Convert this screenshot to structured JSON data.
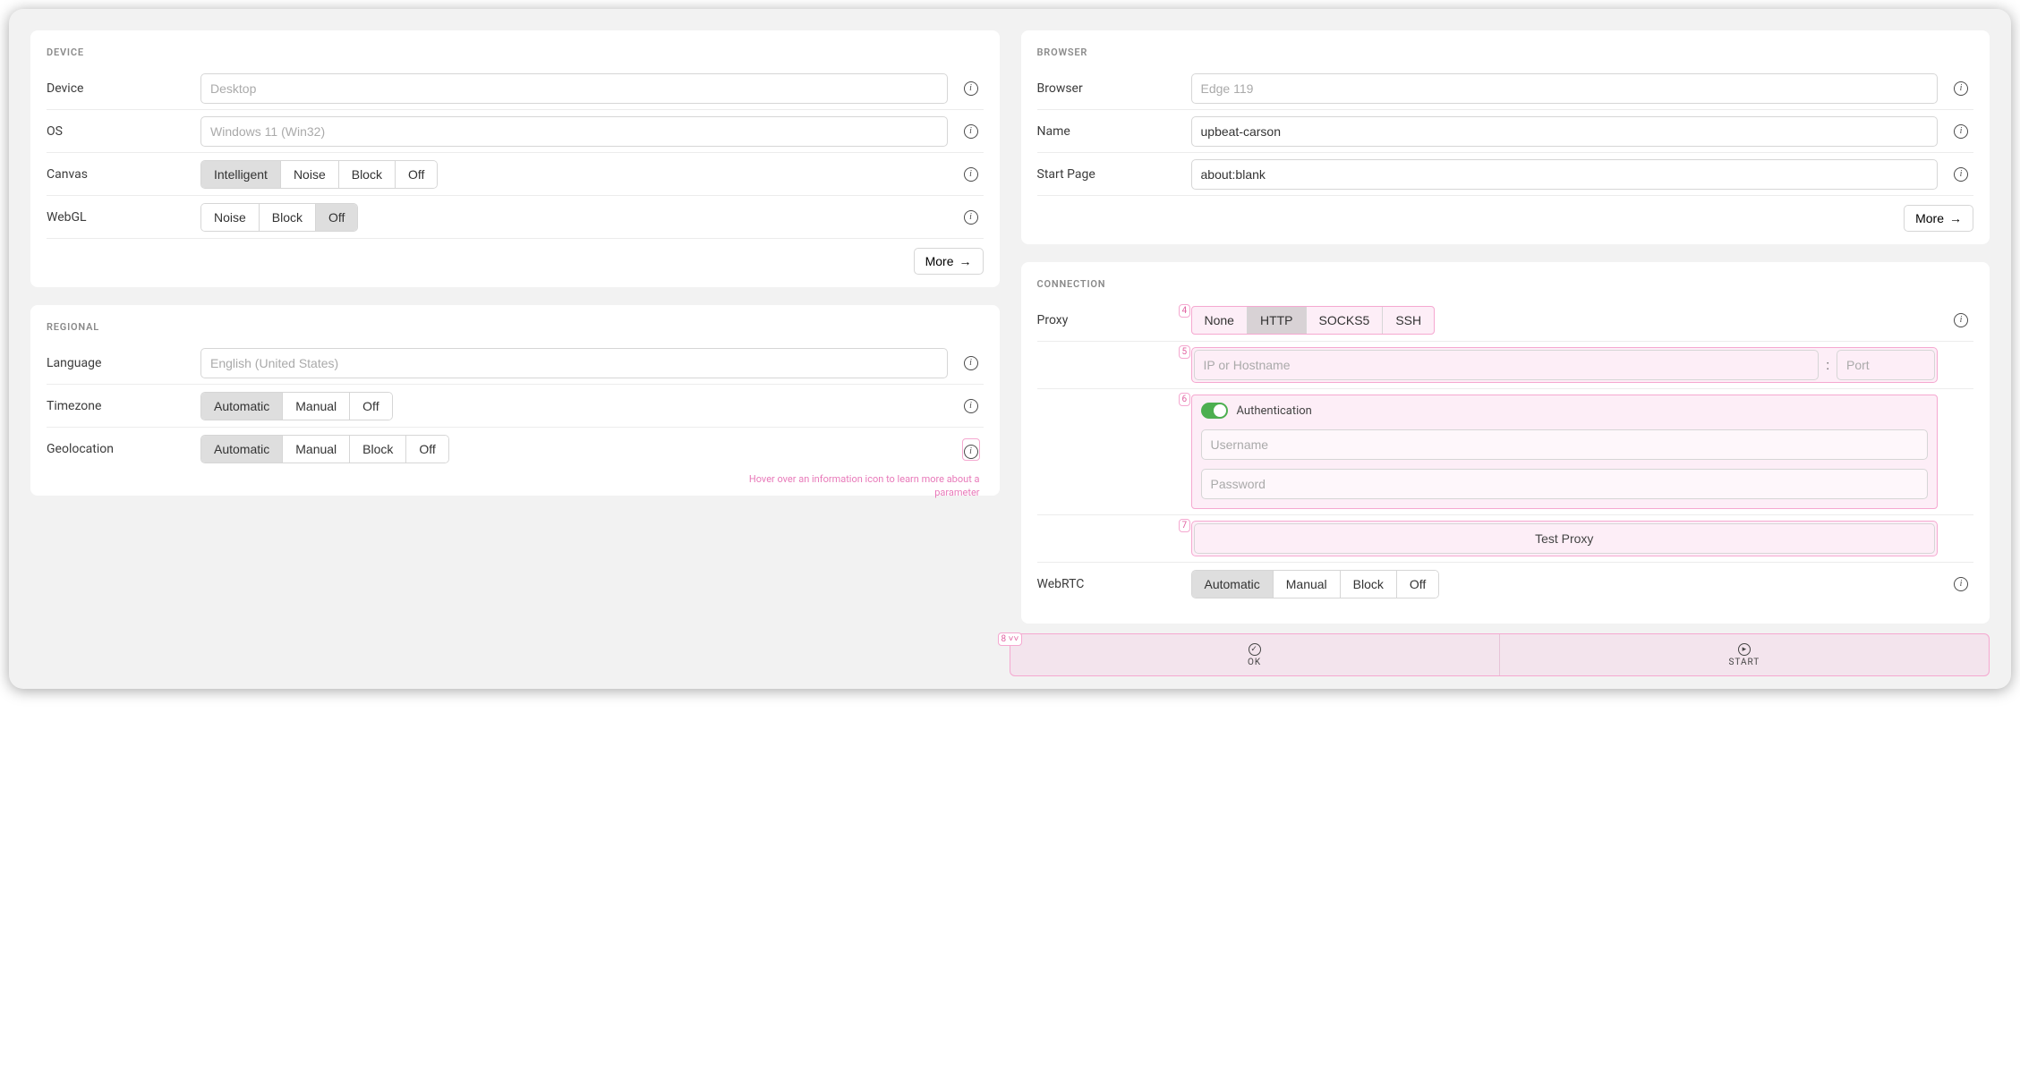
{
  "device": {
    "title": "DEVICE",
    "device_label": "Device",
    "device_placeholder": "Desktop",
    "os_label": "OS",
    "os_placeholder": "Windows 11 (Win32)",
    "canvas_label": "Canvas",
    "canvas_options": [
      "Intelligent",
      "Noise",
      "Block",
      "Off"
    ],
    "canvas_selected": "Intelligent",
    "webgl_label": "WebGL",
    "webgl_options": [
      "Noise",
      "Block",
      "Off"
    ],
    "webgl_selected": "Off",
    "more": "More"
  },
  "regional": {
    "title": "REGIONAL",
    "language_label": "Language",
    "language_placeholder": "English (United States)",
    "timezone_label": "Timezone",
    "timezone_options": [
      "Automatic",
      "Manual",
      "Off"
    ],
    "timezone_selected": "Automatic",
    "geolocation_label": "Geolocation",
    "geolocation_options": [
      "Automatic",
      "Manual",
      "Block",
      "Off"
    ],
    "geolocation_selected": "Automatic",
    "hint": "Hover over an information icon to learn more about a parameter"
  },
  "browser": {
    "title": "BROWSER",
    "browser_label": "Browser",
    "browser_placeholder": "Edge 119",
    "name_label": "Name",
    "name_value": "upbeat-carson",
    "startpage_label": "Start Page",
    "startpage_value": "about:blank",
    "more": "More"
  },
  "connection": {
    "title": "CONNECTION",
    "proxy_label": "Proxy",
    "proxy_options": [
      "None",
      "HTTP",
      "SOCKS5",
      "SSH"
    ],
    "proxy_selected": "HTTP",
    "host_placeholder": "IP or Hostname",
    "port_placeholder": "Port",
    "auth_label": "Authentication",
    "username_placeholder": "Username",
    "password_placeholder": "Password",
    "test_label": "Test Proxy",
    "webrtc_label": "WebRTC",
    "webrtc_options": [
      "Automatic",
      "Manual",
      "Block",
      "Off"
    ],
    "webrtc_selected": "Automatic"
  },
  "footer": {
    "ok": "OK",
    "start": "START"
  },
  "badges": {
    "b4": "4",
    "b5": "5",
    "b6": "6",
    "b7": "7",
    "b8": "8 ˅˅"
  }
}
